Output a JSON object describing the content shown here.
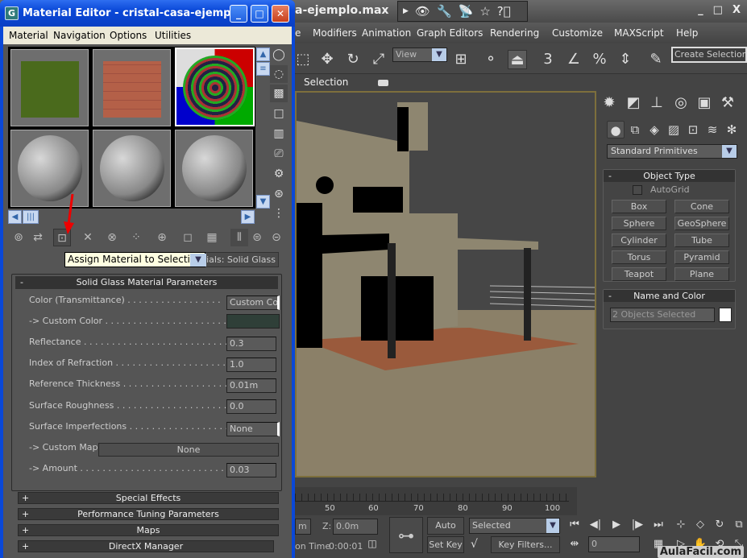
{
  "max_window": {
    "title": "a-ejemplo.max",
    "window_controls": {
      "minimize": "_",
      "maximize": "□",
      "close": "X"
    },
    "quick_access": [
      "binoculars-icon",
      "key-icon",
      "satellite-icon",
      "star-icon",
      "help-icon"
    ],
    "menu": [
      "e",
      "Modifiers",
      "Animation",
      "Graph Editors",
      "Rendering",
      "Customize",
      "MAXScript",
      "Help"
    ],
    "toolbar": {
      "reference_coord": "View",
      "named_selection_set": "Create Selection S"
    },
    "viewport": {
      "label": "Selection"
    },
    "command_panel": {
      "tabs": [
        "create",
        "modify",
        "hierarchy",
        "motion",
        "display",
        "utilities"
      ],
      "subcategories": [
        "geometry",
        "shapes",
        "lights",
        "cameras",
        "helpers",
        "space-warps",
        "systems"
      ],
      "category_dropdown": "Standard Primitives",
      "object_type": {
        "title": "Object Type",
        "autogrid_label": "AutoGrid",
        "autogrid_checked": false,
        "buttons": [
          "Box",
          "Cone",
          "Sphere",
          "GeoSphere",
          "Cylinder",
          "Tube",
          "Torus",
          "Pyramid",
          "Teapot",
          "Plane"
        ]
      },
      "name_and_color": {
        "title": "Name and Color",
        "name_value": "2 Objects Selected",
        "color": "#ffffff"
      }
    },
    "timeline": {
      "labels": [
        "50",
        "60",
        "70",
        "80",
        "90",
        "100"
      ]
    },
    "status": {
      "x_value": "m",
      "z_label": "Z:",
      "z_value": "0.0m",
      "time_label": "on Time",
      "time_value": "0:00:01",
      "auto_key": "Auto Key",
      "set_key": "Set Key",
      "key_mode_dropdown": "Selected",
      "key_filters": "Key Filters...",
      "frame_value": "0"
    },
    "watermark": "AulaFacil.com"
  },
  "material_editor": {
    "title": "Material Editor - cristal-casa-ejemplo",
    "menu": [
      "Material",
      "Navigation",
      "Options",
      "Utilities"
    ],
    "slots": [
      "grass-cube",
      "brick-cube",
      "checker-sphere",
      "gray-sphere",
      "gray-sphere",
      "gray-sphere"
    ],
    "tooltip": "Assign Material to Selection",
    "material_name": "erials: Solid Glass",
    "params": {
      "title": "Solid Glass Material Parameters",
      "color_transmittance": {
        "label": "Color (Transmittance) . . . . . . . . . . . . . . . . .",
        "value": "Custom Colo"
      },
      "custom_color": {
        "label": "-> Custom Color . . . . . . . . . . . . . . . . . . . . . . .",
        "value": "#2f3f38"
      },
      "reflectance": {
        "label": "Reflectance . . . . . . . . . . . . . . . . . . . . . . . . . .",
        "value": "0.3"
      },
      "ior": {
        "label": "Index of Refraction . . . . . . . . . . . . . . . . . . . .",
        "value": "1.0"
      },
      "ref_thickness": {
        "label": "Reference Thickness . . . . . . . . . . . . . . . . . . .",
        "value": "0.01m"
      },
      "roughness": {
        "label": "Surface Roughness . . . . . . . . . . . . . . . . . . . .",
        "value": "0.0"
      },
      "imperfections": {
        "label": "Surface Imperfections . . . . . . . . . . . . . . . . . .",
        "value": "None"
      },
      "custom_map": {
        "label": "-> Custom Map .",
        "value": "None"
      },
      "amount": {
        "label": "-> Amount . . . . . . . . . . . . . . . . . . . . . . . . . . .",
        "value": "0.03"
      }
    },
    "collapsed_rollouts": [
      "Special Effects",
      "Performance Tuning Parameters",
      "Maps",
      "DirectX Manager"
    ]
  }
}
